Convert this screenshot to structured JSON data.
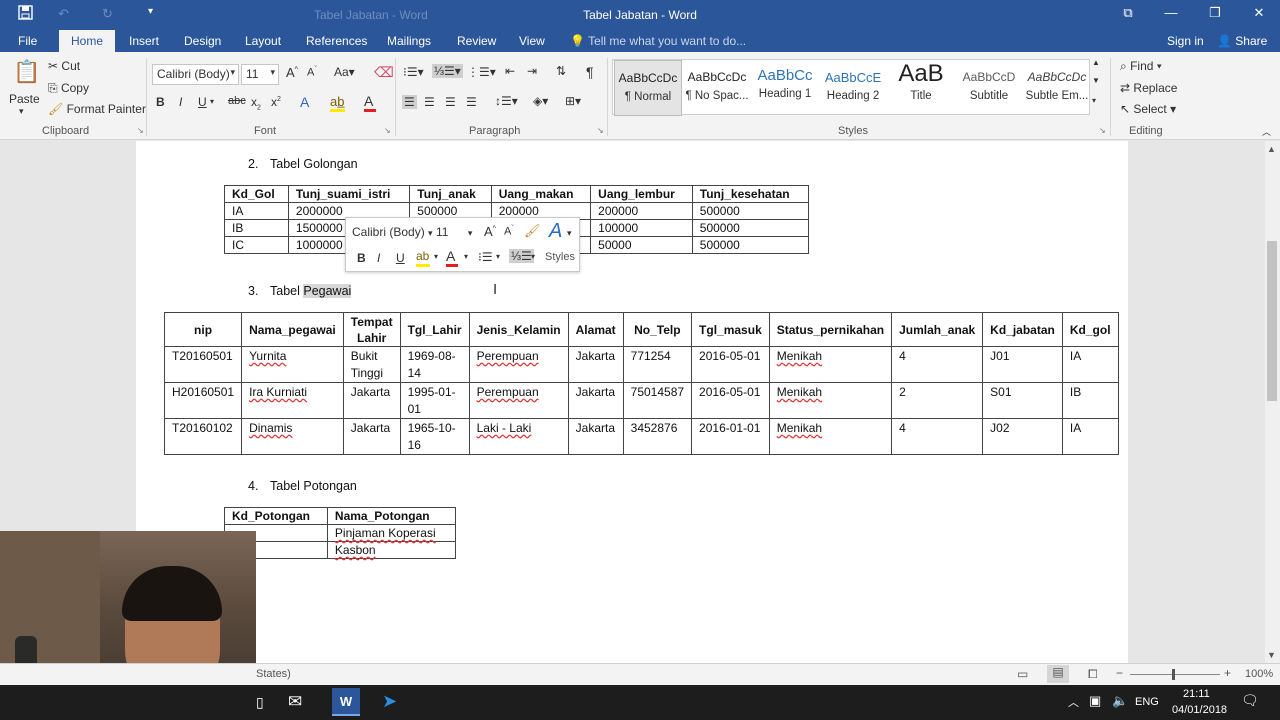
{
  "titlebar": {
    "doc_title": "Tabel Jabatan - Word",
    "ghost_title": "Tabel Jabatan - Word"
  },
  "tabs": [
    "File",
    "Home",
    "Insert",
    "Design",
    "Layout",
    "References",
    "Mailings",
    "Review",
    "View"
  ],
  "tell_me": "Tell me what you want to do...",
  "signin": "Sign in",
  "share": "Share",
  "clipboard": {
    "paste": "Paste",
    "cut": "Cut",
    "copy": "Copy",
    "format_painter": "Format Painter",
    "label": "Clipboard"
  },
  "font": {
    "name": "Calibri (Body)",
    "size": "11",
    "label": "Font"
  },
  "paragraph": {
    "label": "Paragraph"
  },
  "styles": {
    "label": "Styles",
    "items": [
      {
        "preview": "AaBbCcDc",
        "name": "¶ Normal"
      },
      {
        "preview": "AaBbCcDc",
        "name": "¶ No Spac..."
      },
      {
        "preview": "AaBbCc",
        "name": "Heading 1"
      },
      {
        "preview": "AaBbCcE",
        "name": "Heading 2"
      },
      {
        "preview": "AaB",
        "name": "Title"
      },
      {
        "preview": "AaBbCcD",
        "name": "Subtitle"
      },
      {
        "preview": "AaBbCcDc",
        "name": "Subtle Em..."
      }
    ]
  },
  "editing": {
    "find": "Find",
    "replace": "Replace",
    "select": "Select",
    "label": "Editing"
  },
  "doc": {
    "h2": {
      "num": "2.",
      "text": "Tabel Golongan"
    },
    "golongan": {
      "headers": [
        "Kd_Gol",
        "Tunj_suami_istri",
        "Tunj_anak",
        "Uang_makan",
        "Uang_lembur",
        "Tunj_kesehatan"
      ],
      "rows": [
        [
          "IA",
          "2000000",
          "500000",
          "200000",
          "200000",
          "500000"
        ],
        [
          "IB",
          "1500000",
          "",
          "",
          "100000",
          "500000"
        ],
        [
          "IC",
          "1000000",
          "",
          "",
          "50000",
          "500000"
        ]
      ]
    },
    "h3": {
      "num": "3.",
      "text_a": "Tabel ",
      "text_b": "Pegawai"
    },
    "pegawai": {
      "headers": [
        "nip",
        "Nama_pegawai",
        "Tempat Lahir",
        "Tgl_Lahir",
        "Jenis_Kelamin",
        "Alamat",
        "No_Telp",
        "Tgl_masuk",
        "Status_pernikahan",
        "Jumlah_anak",
        "Kd_jabatan",
        "Kd_gol"
      ],
      "rows": [
        [
          "T20160501",
          "Yurnita",
          "Bukit Tinggi",
          "1969-08-14",
          "Perempuan",
          "Jakarta",
          "771254",
          "2016-05-01",
          "Menikah",
          "4",
          "J01",
          "IA"
        ],
        [
          "H20160501",
          "Ira Kurniati",
          "Jakarta",
          "1995-01-01",
          "Perempuan",
          "Jakarta",
          "75014587",
          "2016-05-01",
          "Menikah",
          "2",
          "S01",
          "IB"
        ],
        [
          "T20160102",
          "Dinamis",
          "Jakarta",
          "1965-10-16",
          "Laki - Laki",
          "Jakarta",
          "3452876",
          "2016-01-01",
          "Menikah",
          "4",
          "J02",
          "IA"
        ]
      ]
    },
    "h4": {
      "num": "4.",
      "text": "Tabel Potongan"
    },
    "potongan": {
      "headers": [
        "Kd_Potongan",
        "Nama_Potongan"
      ],
      "rows": [
        [
          "",
          "Pinjaman Koperasi"
        ],
        [
          "",
          "Kasbon"
        ]
      ]
    }
  },
  "mini_toolbar": {
    "font": "Calibri (Body)",
    "size": "11",
    "styles": "Styles"
  },
  "status": {
    "text": "States)",
    "zoom": "100%"
  },
  "taskbar": {
    "lang": "ENG",
    "time": "21:11",
    "date": "04/01/2018"
  }
}
